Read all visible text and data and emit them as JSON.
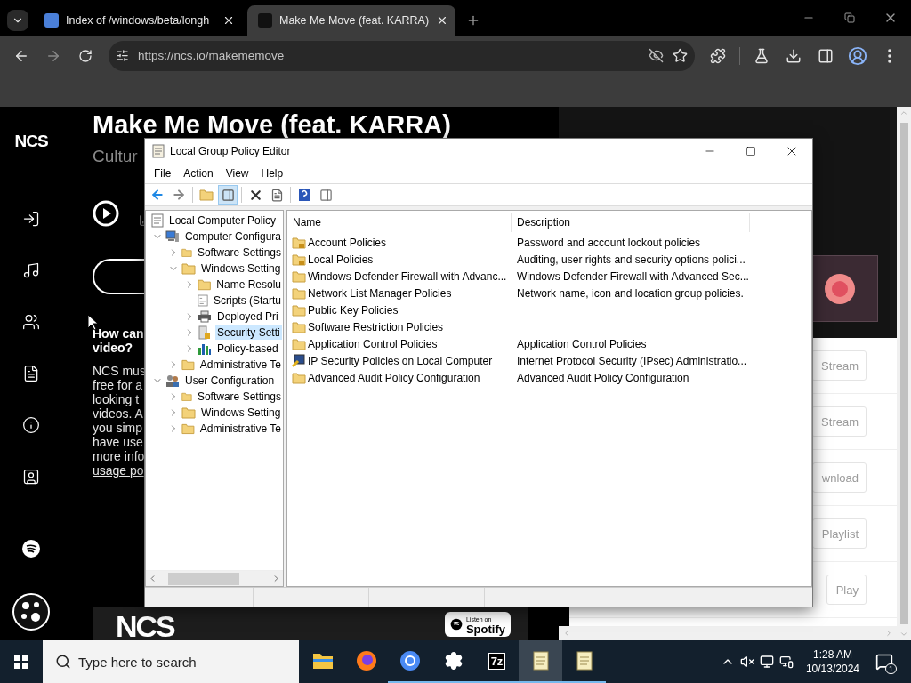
{
  "browser": {
    "tabs": [
      {
        "title": "Index of /windows/beta/longh",
        "selected": false
      },
      {
        "title": "Make Me Move (feat. KARRA)",
        "selected": true
      }
    ],
    "address": "https://ncs.io/makememove"
  },
  "page": {
    "sidebar_logo": "NCS",
    "title": "Make Me Move (feat. KARRA)",
    "subtitle": "Cultur",
    "question_lines": [
      "How can",
      "video?"
    ],
    "paragraph_lines": [
      "NCS mus",
      "free for a",
      "looking t",
      "videos. A",
      "you simp",
      "have use",
      "more info"
    ],
    "link": "usage po",
    "banner": {
      "logo": "NCS",
      "badge_small": "Listen on",
      "badge_brand": "Spotify"
    },
    "actions": [
      "Stream",
      "Stream",
      "wnload",
      "Playlist",
      "Play"
    ]
  },
  "gpo": {
    "title": "Local Group Policy Editor",
    "menu": [
      "File",
      "Action",
      "View",
      "Help"
    ],
    "tree": [
      {
        "label": "Local Computer Policy",
        "kind": "policy",
        "selected": false,
        "children": [
          {
            "label": "Computer Configura",
            "kind": "computer",
            "expanded": true,
            "selected": false,
            "children": [
              {
                "label": "Software Settings",
                "kind": "folder",
                "expanded": false,
                "selected": false
              },
              {
                "label": "Windows Setting",
                "kind": "folder",
                "expanded": true,
                "selected": false,
                "children": [
                  {
                    "label": "Name Resolu",
                    "kind": "folder",
                    "expanded": false,
                    "selected": false
                  },
                  {
                    "label": "Scripts (Startu",
                    "kind": "script",
                    "selected": false
                  },
                  {
                    "label": "Deployed Pri",
                    "kind": "printer",
                    "expanded": false,
                    "selected": false
                  },
                  {
                    "label": "Security Setti",
                    "kind": "security",
                    "expanded": false,
                    "selected": true
                  },
                  {
                    "label": "Policy-based",
                    "kind": "chart",
                    "expanded": false,
                    "selected": false
                  }
                ]
              },
              {
                "label": "Administrative Te",
                "kind": "folder",
                "expanded": false,
                "selected": false
              }
            ]
          },
          {
            "label": "User Configuration",
            "kind": "user",
            "expanded": true,
            "selected": false,
            "children": [
              {
                "label": "Software Settings",
                "kind": "folder",
                "expanded": false,
                "selected": false
              },
              {
                "label": "Windows Setting",
                "kind": "folder",
                "expanded": false,
                "selected": false
              },
              {
                "label": "Administrative Te",
                "kind": "folder",
                "expanded": false,
                "selected": false
              }
            ]
          }
        ]
      }
    ],
    "columns": [
      "Name",
      "Description"
    ],
    "rows": [
      {
        "name": "Account Policies",
        "kind": "locked-folder",
        "description": "Password and account lockout policies"
      },
      {
        "name": "Local Policies",
        "kind": "locked-folder",
        "description": "Auditing, user rights and security options polici..."
      },
      {
        "name": "Windows Defender Firewall with Advanc...",
        "kind": "folder",
        "description": "Windows Defender Firewall with Advanced Sec..."
      },
      {
        "name": "Network List Manager Policies",
        "kind": "folder",
        "description": "Network name, icon and location group policies."
      },
      {
        "name": "Public Key Policies",
        "kind": "folder"
      },
      {
        "name": "Software Restriction Policies",
        "kind": "folder"
      },
      {
        "name": "Application Control Policies",
        "kind": "folder",
        "description": "Application Control Policies"
      },
      {
        "name": "IP Security Policies on Local Computer",
        "kind": "ip-security",
        "description": "Internet Protocol Security (IPsec) Administratio..."
      },
      {
        "name": "Advanced Audit Policy Configuration",
        "kind": "folder",
        "description": "Advanced Audit Policy Configuration"
      }
    ]
  },
  "taskbar": {
    "search": {
      "placeholder": "Type here to search"
    },
    "apps": [
      {
        "kind": "explorer",
        "running": false,
        "active": false
      },
      {
        "kind": "firefox",
        "running": false,
        "active": false
      },
      {
        "kind": "chrome",
        "running": true,
        "active": false
      },
      {
        "kind": "settings",
        "running": true,
        "active": false
      },
      {
        "kind": "archiver",
        "label": "7z",
        "running": true,
        "active": false
      },
      {
        "kind": "notepad",
        "running": true,
        "active": true
      },
      {
        "kind": "notepad",
        "running": true,
        "active": false
      }
    ],
    "time": "1:28 AM",
    "date": "10/13/2024",
    "notifications": "1"
  }
}
